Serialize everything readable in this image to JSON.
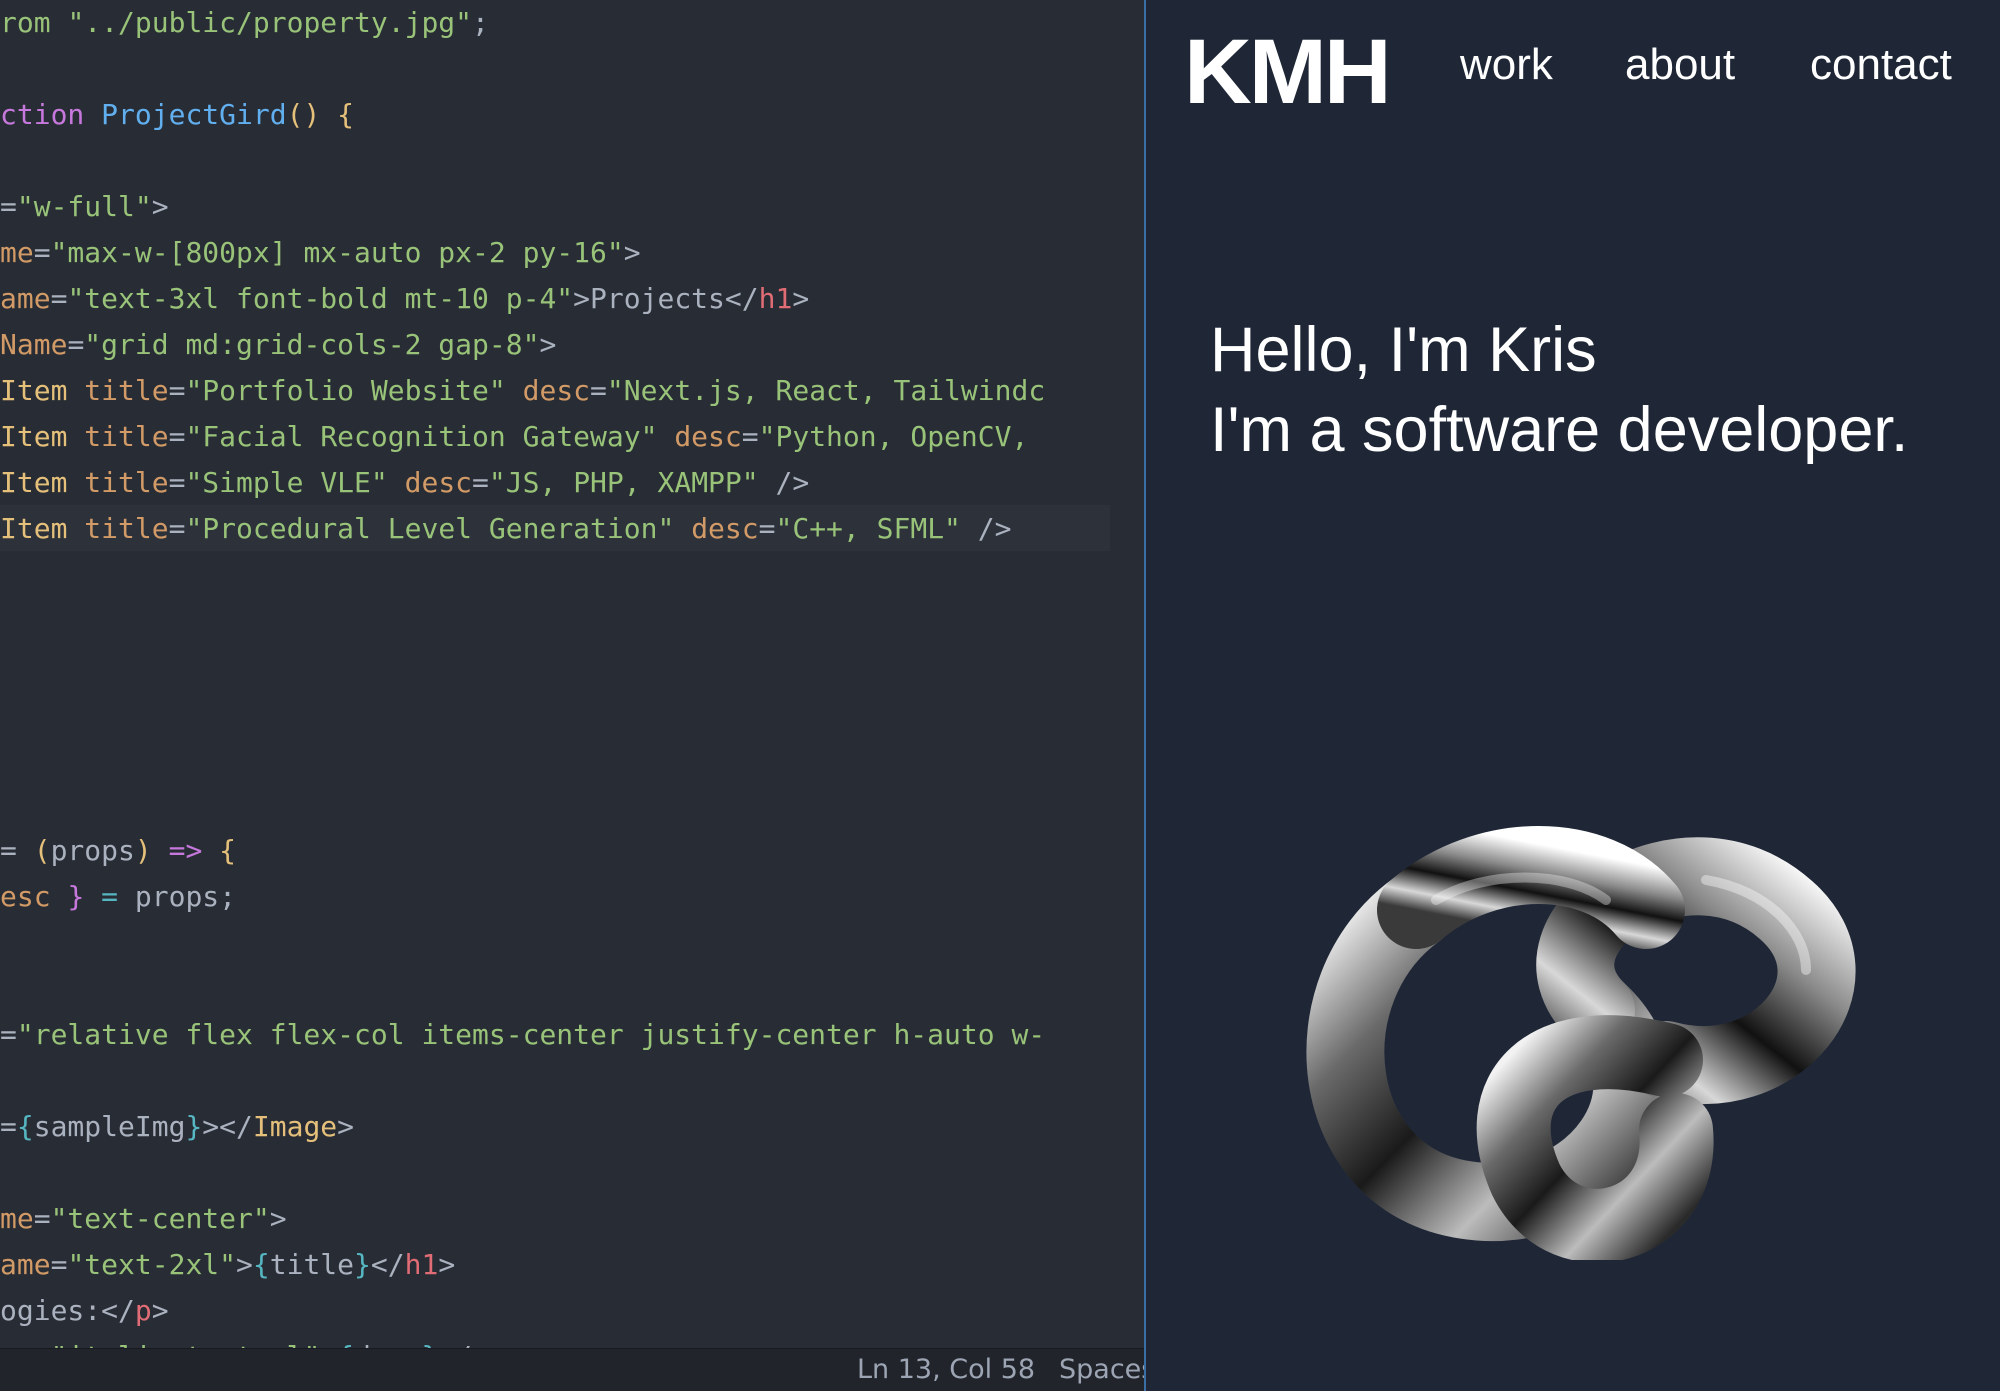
{
  "editor": {
    "code_lines": [
      [
        {
          "c": "str",
          "t": "rom"
        },
        {
          "c": "pun",
          "t": " "
        },
        {
          "c": "str",
          "t": "\"../public/property.jpg\""
        },
        {
          "c": "pun",
          "t": ";"
        }
      ],
      [],
      [
        {
          "c": "kw",
          "t": "ction"
        },
        {
          "c": "pun",
          "t": " "
        },
        {
          "c": "fn",
          "t": "ProjectGird"
        },
        {
          "c": "br1",
          "t": "()"
        },
        {
          "c": "pun",
          "t": " "
        },
        {
          "c": "br1",
          "t": "{"
        }
      ],
      [],
      [
        {
          "c": "pun",
          "t": "="
        },
        {
          "c": "str",
          "t": "\"w-full\""
        },
        {
          "c": "pun",
          "t": ">"
        }
      ],
      [
        {
          "c": "attr",
          "t": "me"
        },
        {
          "c": "pun",
          "t": "="
        },
        {
          "c": "str",
          "t": "\"max-w-[800px] mx-auto px-2 py-16\""
        },
        {
          "c": "pun",
          "t": ">"
        }
      ],
      [
        {
          "c": "attr",
          "t": "ame"
        },
        {
          "c": "pun",
          "t": "="
        },
        {
          "c": "str",
          "t": "\"text-3xl font-bold mt-10 p-4\""
        },
        {
          "c": "pun",
          "t": ">Projects</"
        },
        {
          "c": "tag",
          "t": "h1"
        },
        {
          "c": "pun",
          "t": ">"
        }
      ],
      [
        {
          "c": "attr",
          "t": "Name"
        },
        {
          "c": "pun",
          "t": "="
        },
        {
          "c": "str",
          "t": "\"grid md:grid-cols-2 gap-8\""
        },
        {
          "c": "pun",
          "t": ">"
        }
      ],
      [
        {
          "c": "cls",
          "t": "Item"
        },
        {
          "c": "pun",
          "t": " "
        },
        {
          "c": "attr",
          "t": "title"
        },
        {
          "c": "pun",
          "t": "="
        },
        {
          "c": "str",
          "t": "\"Portfolio Website\""
        },
        {
          "c": "pun",
          "t": " "
        },
        {
          "c": "attr",
          "t": "desc"
        },
        {
          "c": "pun",
          "t": "="
        },
        {
          "c": "str",
          "t": "\"Next.js, React, Tailwindc"
        }
      ],
      [
        {
          "c": "cls",
          "t": "Item"
        },
        {
          "c": "pun",
          "t": " "
        },
        {
          "c": "attr",
          "t": "title"
        },
        {
          "c": "pun",
          "t": "="
        },
        {
          "c": "str",
          "t": "\"Facial Recognition Gateway\""
        },
        {
          "c": "pun",
          "t": " "
        },
        {
          "c": "attr",
          "t": "desc"
        },
        {
          "c": "pun",
          "t": "="
        },
        {
          "c": "str",
          "t": "\"Python, OpenCV,"
        }
      ],
      [
        {
          "c": "cls",
          "t": "Item"
        },
        {
          "c": "pun",
          "t": " "
        },
        {
          "c": "attr",
          "t": "title"
        },
        {
          "c": "pun",
          "t": "="
        },
        {
          "c": "str",
          "t": "\"Simple VLE\""
        },
        {
          "c": "pun",
          "t": " "
        },
        {
          "c": "attr",
          "t": "desc"
        },
        {
          "c": "pun",
          "t": "="
        },
        {
          "c": "str",
          "t": "\"JS, PHP, XAMPP\""
        },
        {
          "c": "pun",
          "t": " />"
        }
      ],
      [
        {
          "c": "cls",
          "t": "Item"
        },
        {
          "c": "pun",
          "t": " "
        },
        {
          "c": "attr",
          "t": "title"
        },
        {
          "c": "pun",
          "t": "="
        },
        {
          "c": "str",
          "t": "\"Procedural Level Generation\""
        },
        {
          "c": "pun",
          "t": " "
        },
        {
          "c": "attr",
          "t": "desc"
        },
        {
          "c": "pun",
          "t": "="
        },
        {
          "c": "str",
          "t": "\"C++, SFML\""
        },
        {
          "c": "pun",
          "t": " />"
        }
      ],
      [],
      [],
      [],
      [],
      [],
      [],
      [
        {
          "c": "pun",
          "t": "= "
        },
        {
          "c": "br1",
          "t": "("
        },
        {
          "c": "pun",
          "t": "props"
        },
        {
          "c": "br1",
          "t": ")"
        },
        {
          "c": "pun",
          "t": " "
        },
        {
          "c": "kw",
          "t": "=>"
        },
        {
          "c": "pun",
          "t": " "
        },
        {
          "c": "br1",
          "t": "{"
        }
      ],
      [
        {
          "c": "attr",
          "t": "esc"
        },
        {
          "c": "pun",
          "t": " "
        },
        {
          "c": "br2",
          "t": "}"
        },
        {
          "c": "pun",
          "t": " "
        },
        {
          "c": "op",
          "t": "="
        },
        {
          "c": "pun",
          "t": " props;"
        }
      ],
      [],
      [],
      [
        {
          "c": "pun",
          "t": "="
        },
        {
          "c": "str",
          "t": "\"relative flex flex-col items-center justify-center h-auto w-"
        }
      ],
      [],
      [
        {
          "c": "pun",
          "t": "="
        },
        {
          "c": "br3",
          "t": "{"
        },
        {
          "c": "pun",
          "t": "sampleImg"
        },
        {
          "c": "br3",
          "t": "}"
        },
        {
          "c": "pun",
          "t": "></"
        },
        {
          "c": "cls",
          "t": "Image"
        },
        {
          "c": "pun",
          "t": ">"
        }
      ],
      [],
      [
        {
          "c": "attr",
          "t": "me"
        },
        {
          "c": "pun",
          "t": "="
        },
        {
          "c": "str",
          "t": "\"text-center\""
        },
        {
          "c": "pun",
          "t": ">"
        }
      ],
      [
        {
          "c": "attr",
          "t": "ame"
        },
        {
          "c": "pun",
          "t": "="
        },
        {
          "c": "str",
          "t": "\"text-2xl\""
        },
        {
          "c": "pun",
          "t": ">"
        },
        {
          "c": "br3",
          "t": "{"
        },
        {
          "c": "pun",
          "t": "title"
        },
        {
          "c": "br3",
          "t": "}"
        },
        {
          "c": "pun",
          "t": "</"
        },
        {
          "c": "tag",
          "t": "h1"
        },
        {
          "c": "pun",
          "t": ">"
        }
      ],
      [
        {
          "c": "pun",
          "t": "ogies:</"
        },
        {
          "c": "tag",
          "t": "p"
        },
        {
          "c": "pun",
          "t": ">"
        }
      ],
      [
        {
          "c": "attr",
          "t": "me"
        },
        {
          "c": "pun",
          "t": "="
        },
        {
          "c": "str",
          "t": "\"italic text-xl\""
        },
        {
          "c": "pun",
          "t": ">"
        },
        {
          "c": "br3",
          "t": "{"
        },
        {
          "c": "pun",
          "t": "desc"
        },
        {
          "c": "br3",
          "t": "}"
        },
        {
          "c": "pun",
          "t": "</"
        },
        {
          "c": "tag",
          "t": "p"
        },
        {
          "c": "pun",
          "t": ">"
        }
      ]
    ]
  },
  "statusbar": {
    "cursor_position": "Ln 13, Col 58",
    "indentation": "Spaces"
  },
  "preview": {
    "logo_text": "KMH",
    "nav_items": [
      "work",
      "about",
      "contact"
    ],
    "hero_line1": "Hello, I'm Kris",
    "hero_line2": "I'm a software developer."
  },
  "colors": {
    "editor_bg": "#282c34",
    "preview_bg": "#1f2737",
    "divider": "#3b6ea5"
  },
  "icons": [
    "torus-knot-3d-render"
  ]
}
